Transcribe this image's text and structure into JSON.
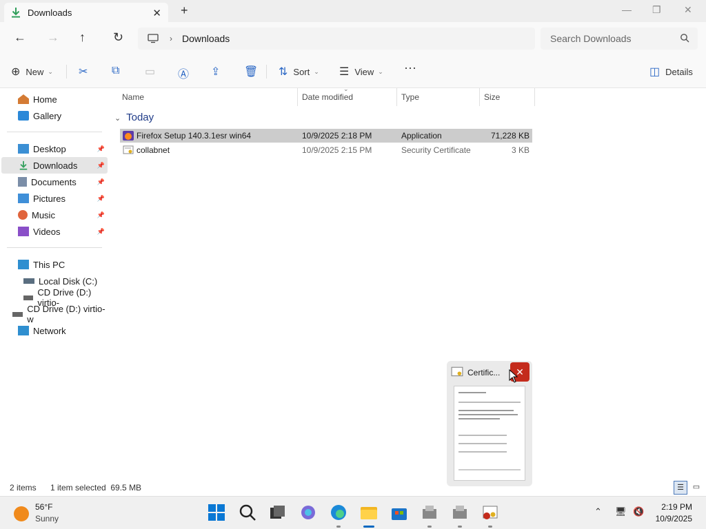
{
  "window": {
    "tab_title": "Downloads",
    "tab_close": "✕",
    "new_tab": "+"
  },
  "address": {
    "path": "Downloads",
    "separator": "›",
    "search_placeholder": "Search Downloads"
  },
  "commands": {
    "new_label": "New",
    "sort_label": "Sort",
    "view_label": "View",
    "more_label": "···",
    "details_label": "Details"
  },
  "sidebar": {
    "items": [
      {
        "label": "Home",
        "pinned": false,
        "color": "#d47b34"
      },
      {
        "label": "Gallery",
        "pinned": false,
        "color": "#2b88d8"
      },
      {
        "label": "Desktop",
        "pinned": true,
        "color": "#3b8fd4"
      },
      {
        "label": "Downloads",
        "pinned": true,
        "color": "#2f9e5a",
        "selected": true
      },
      {
        "label": "Documents",
        "pinned": true,
        "color": "#7b8ea8"
      },
      {
        "label": "Pictures",
        "pinned": true,
        "color": "#3f8fd8"
      },
      {
        "label": "Music",
        "pinned": true,
        "color": "#e0643c"
      },
      {
        "label": "Videos",
        "pinned": true,
        "color": "#8a4fc8"
      },
      {
        "label": "This PC",
        "pinned": false,
        "color": "#2f8fd0"
      },
      {
        "label": "Local Disk (C:)",
        "pinned": false,
        "color": "#5a6e80"
      },
      {
        "label": "CD Drive (D:) virtio-",
        "pinned": false,
        "color": "#666666"
      },
      {
        "label": "CD Drive (D:) virtio-w",
        "pinned": false,
        "color": "#666666"
      },
      {
        "label": "Network",
        "pinned": false,
        "color": "#2f8fd0"
      }
    ]
  },
  "columns": {
    "name": "Name",
    "date": "Date modified",
    "type": "Type",
    "size": "Size"
  },
  "group_label": "Today",
  "files": [
    {
      "name": "Firefox Setup 140.3.1esr win64",
      "date": "10/9/2025 2:18 PM",
      "type": "Application",
      "size": "71,228 KB",
      "selected": true
    },
    {
      "name": "collabnet",
      "date": "10/9/2025 2:15 PM",
      "type": "Security Certificate",
      "size": "3 KB",
      "selected": false
    }
  ],
  "status": {
    "count": "2 items",
    "selection": "1 item selected  69.5 MB"
  },
  "thumbnail": {
    "title": "Certific...",
    "close": "✕"
  },
  "taskbar": {
    "temp": "56°F",
    "condition": "Sunny",
    "time": "2:19 PM",
    "date": "10/9/2025"
  }
}
